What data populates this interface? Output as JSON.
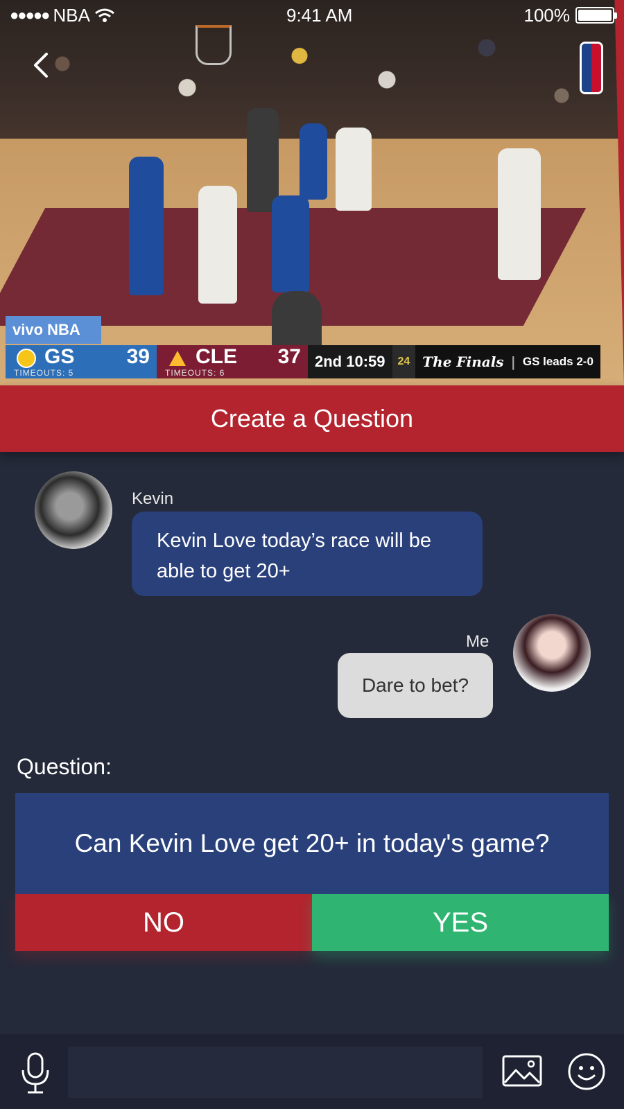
{
  "status_bar": {
    "carrier": "NBA",
    "signal_dots": "●●●●●",
    "time": "9:41 AM",
    "battery": "100%",
    "battery_level": 1.0
  },
  "video": {
    "overlay_brand": "vivo NBA",
    "scoreboard": {
      "away_team": "GS",
      "away_score": "39",
      "away_timeouts": "TIMEOUTS: 5",
      "home_team": "CLE",
      "home_score": "37",
      "home_timeouts": "TIMEOUTS: 6",
      "clock": "2nd 10:59",
      "shot_clock": "24",
      "event": "The Finals",
      "series_status": "GS leads 2-0"
    }
  },
  "header": {
    "title": "Create a Question"
  },
  "chat": {
    "messages": [
      {
        "sender": "Kevin",
        "text": "Kevin Love today’s race will be able to get 20+"
      },
      {
        "sender": "Me",
        "text": "Dare to bet?"
      }
    ]
  },
  "question": {
    "label": "Question:",
    "text": "Can Kevin Love get 20+ in today's game?",
    "no_label": "NO",
    "yes_label": "YES"
  },
  "input_bar": {
    "placeholder": "",
    "icons": [
      "microphone-icon",
      "image-icon",
      "emoji-icon"
    ]
  },
  "colors": {
    "accent_red": "#b3242f",
    "accent_green": "#2fb571",
    "card_blue": "#29407a",
    "background": "#252a3a"
  }
}
